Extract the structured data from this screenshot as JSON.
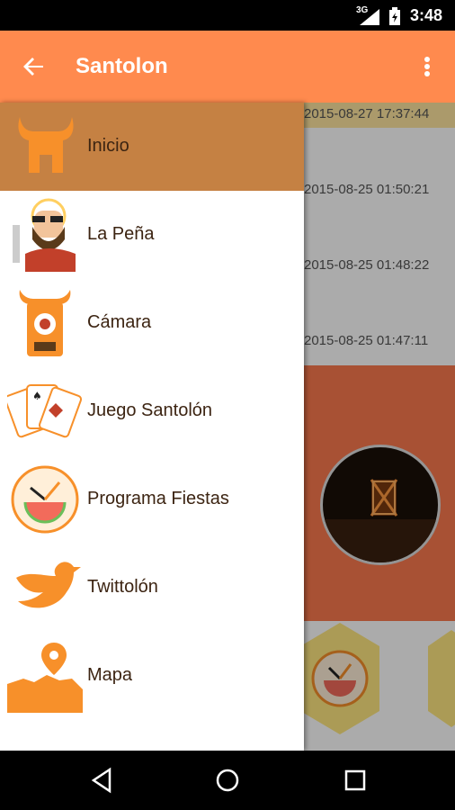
{
  "status_bar": {
    "network": "3G",
    "time": "3:48"
  },
  "app_bar": {
    "title": "Santolon",
    "back_icon": "arrow-back-icon",
    "menu_icon": "more-vert-icon"
  },
  "drawer": {
    "items": [
      {
        "label": "Inicio",
        "icon": "bull-house-icon",
        "selected": true
      },
      {
        "label": "La Peña",
        "icon": "bearded-man-icon",
        "selected": false
      },
      {
        "label": "Cámara",
        "icon": "camera-bull-icon",
        "selected": false
      },
      {
        "label": "Juego Santolón",
        "icon": "playing-cards-icon",
        "selected": false
      },
      {
        "label": "Programa Fiestas",
        "icon": "clock-watermelon-icon",
        "selected": false
      },
      {
        "label": "Twittolón",
        "icon": "bird-icon",
        "selected": false
      },
      {
        "label": "Mapa",
        "icon": "map-pin-icon",
        "selected": false
      }
    ]
  },
  "background": {
    "timestamps": [
      "2015-08-27 17:37:44",
      "2015-08-25 01:50:21",
      "2015-08-25 01:48:22",
      "2015-08-25 01:47:11"
    ]
  },
  "colors": {
    "accent": "#ff8a4e",
    "selected": "#c58143",
    "icon_orange": "#f7902a"
  }
}
